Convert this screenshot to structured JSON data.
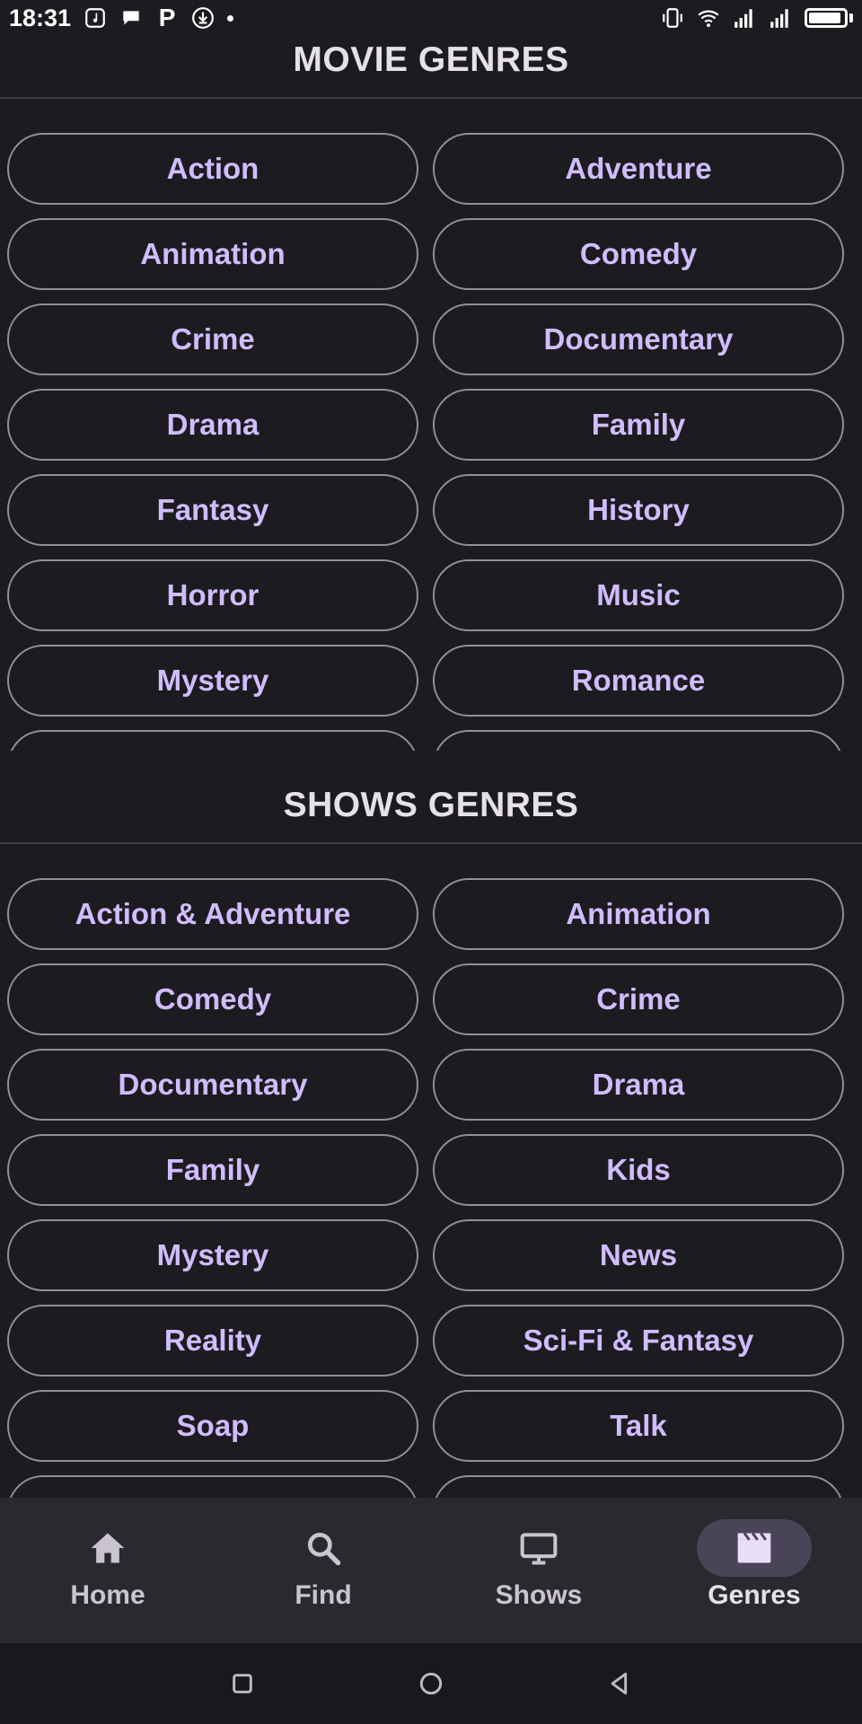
{
  "status_bar": {
    "time": "18:31",
    "left_icons": [
      "music-app-icon",
      "chat-icon",
      "p-app-icon",
      "download-icon"
    ],
    "p_letter": "P",
    "right_icons": [
      "vibrate-icon",
      "wifi-icon",
      "signal-icon",
      "signal-icon",
      "battery-icon"
    ]
  },
  "movie_section": {
    "title": "MOVIE GENRES",
    "genres": [
      "Action",
      "Adventure",
      "Animation",
      "Comedy",
      "Crime",
      "Documentary",
      "Drama",
      "Family",
      "Fantasy",
      "History",
      "Horror",
      "Music",
      "Mystery",
      "Romance",
      "",
      ""
    ]
  },
  "shows_section": {
    "title": "SHOWS GENRES",
    "genres": [
      "Action & Adventure",
      "Animation",
      "Comedy",
      "Crime",
      "Documentary",
      "Drama",
      "Family",
      "Kids",
      "Mystery",
      "News",
      "Reality",
      "Sci-Fi & Fantasy",
      "Soap",
      "Talk",
      "",
      ""
    ]
  },
  "bottom_nav": {
    "items": [
      {
        "label": "Home",
        "icon": "home-icon",
        "active": false
      },
      {
        "label": "Find",
        "icon": "search-icon",
        "active": false
      },
      {
        "label": "Shows",
        "icon": "tv-icon",
        "active": false
      },
      {
        "label": "Genres",
        "icon": "movie-clapper-icon",
        "active": true
      }
    ]
  },
  "system_nav": {
    "items": [
      "recents-icon",
      "home-circle-icon",
      "back-icon"
    ]
  },
  "colors": {
    "background": "#1c1b1f",
    "chip_text": "#d0bcff",
    "chip_border": "#938f99",
    "nav_background": "#2b2930",
    "nav_active_indicator": "#4a4458"
  }
}
